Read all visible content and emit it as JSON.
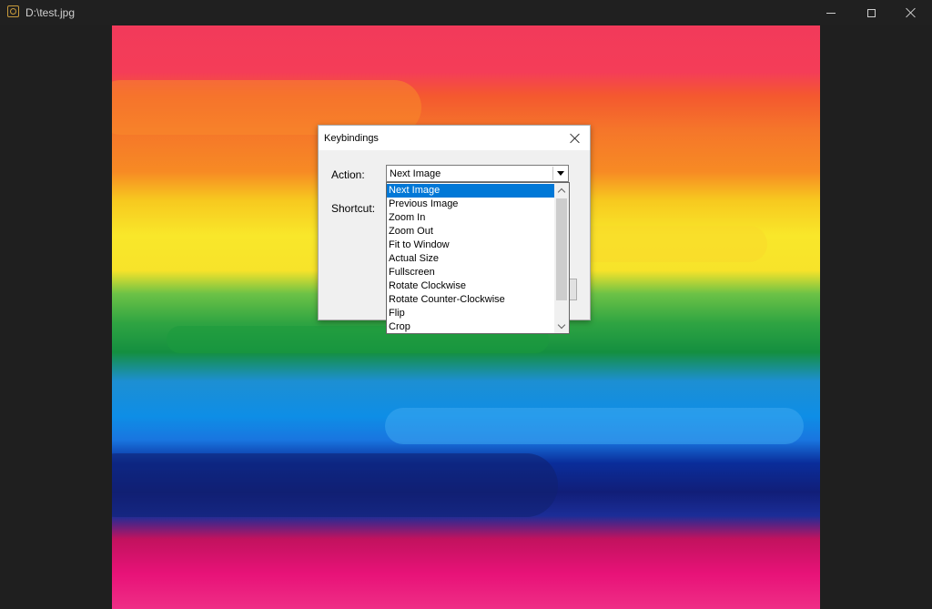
{
  "window": {
    "title": "D:\\test.jpg",
    "icon": "image-viewer-app-icon"
  },
  "titlebar_controls": {
    "minimize_icon": "minimize-icon",
    "maximize_icon": "maximize-icon",
    "close_icon": "close-icon"
  },
  "image": {
    "description_colors": [
      "#f23a5a",
      "#f5762a",
      "#f9e72a",
      "#2fa442",
      "#0e8ee6",
      "#111e78",
      "#e81278"
    ]
  },
  "dialog": {
    "title": "Keybindings",
    "action_label": "Action:",
    "shortcut_label": "Shortcut:",
    "action_value": "Next Image"
  },
  "dropdown": {
    "selected_index": 0,
    "items": [
      "Next Image",
      "Previous Image",
      "Zoom In",
      "Zoom Out",
      "Fit to Window",
      "Actual Size",
      "Fullscreen",
      "Rotate Clockwise",
      "Rotate Counter-Clockwise",
      "Flip",
      "Crop"
    ]
  },
  "colors": {
    "selection": "#0078d7",
    "titlebar": "#202020",
    "background": "#1f1f1f"
  }
}
